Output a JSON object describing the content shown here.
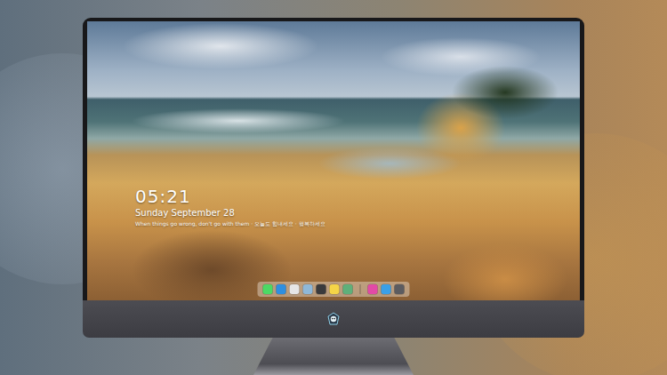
{
  "clock": {
    "time": "05:21",
    "date": "Sunday September 28",
    "quote": "When things go wrong, don't go with them · 오늘도 힘내세요 · 행복하세요"
  },
  "dock": {
    "pinned": [
      {
        "color": "#4cd964"
      },
      {
        "color": "#2f8fe0"
      },
      {
        "color": "#e6e6e6"
      },
      {
        "color": "#8fb8d8"
      },
      {
        "color": "#3a3a3c"
      },
      {
        "color": "#f5d547"
      },
      {
        "color": "#5fb07a"
      }
    ],
    "recent": [
      {
        "color": "#e24aa6"
      },
      {
        "color": "#3aa0e8"
      },
      {
        "color": "#5c5c60"
      }
    ]
  }
}
